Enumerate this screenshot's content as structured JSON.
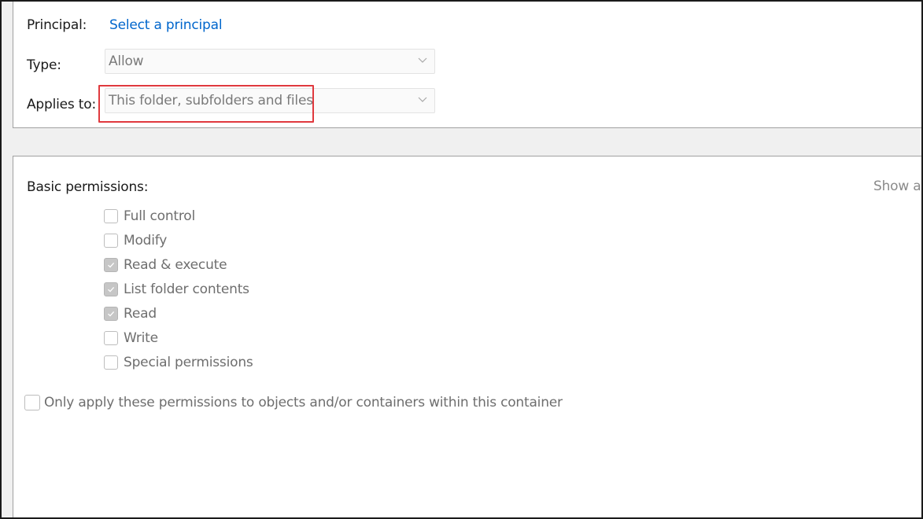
{
  "header": {
    "principal_label": "Principal:",
    "principal_link": "Select a principal",
    "type_label": "Type:",
    "type_value": "Allow",
    "applies_label": "Applies to:",
    "applies_value": "This folder, subfolders and files"
  },
  "permissions": {
    "heading": "Basic permissions:",
    "show_advanced": "Show ac",
    "items": [
      {
        "label": "Full control",
        "checked": false
      },
      {
        "label": "Modify",
        "checked": false
      },
      {
        "label": "Read & execute",
        "checked": true
      },
      {
        "label": "List folder contents",
        "checked": true
      },
      {
        "label": "Read",
        "checked": true
      },
      {
        "label": "Write",
        "checked": false
      },
      {
        "label": "Special permissions",
        "checked": false
      }
    ],
    "only_apply": {
      "label": "Only apply these permissions to objects and/or containers within this container",
      "checked": false
    }
  },
  "icons": {
    "chevron": "chevron-down-icon",
    "check": "checkmark-icon"
  },
  "colors": {
    "link": "#0066cc",
    "highlight": "#e0393e",
    "disabled_text": "#6e6e6e",
    "checked_fill": "#c6c6c6"
  }
}
